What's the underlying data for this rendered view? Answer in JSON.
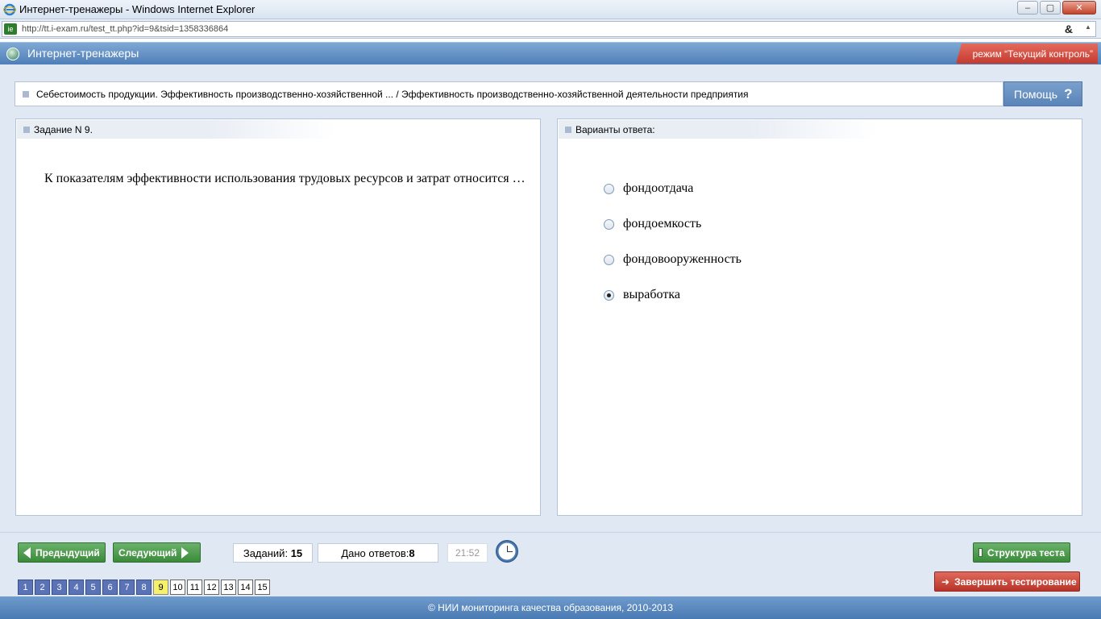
{
  "window": {
    "title": "Интернет-тренажеры - Windows Internet Explorer",
    "url": "http://tt.i-exam.ru/test_tt.php?id=9&tsid=1358336864"
  },
  "header": {
    "app_title": "Интернет-тренажеры",
    "mode": "режим “Текущий контроль”"
  },
  "breadcrumb": "Себестоимость продукции. Эффективность производственно-хозяйственной ... / Эффективность производственно-хозяйственной деятельности предприятия",
  "help_label": "Помощь",
  "task": {
    "heading": "Задание N 9.",
    "question": "К показателям эффективности использования трудовых ресурсов и затрат относится …"
  },
  "answers": {
    "heading": "Варианты ответа:",
    "options": [
      {
        "label": "фондоотдача",
        "selected": false
      },
      {
        "label": "фондоемкость",
        "selected": false
      },
      {
        "label": "фондовооруженность",
        "selected": false
      },
      {
        "label": "выработка",
        "selected": true
      }
    ]
  },
  "toolbar": {
    "prev_label": "Предыдущий",
    "next_label": "Следующий",
    "tasks_label": "Заданий:",
    "tasks_count": "15",
    "answered_label": "Дано ответов:",
    "answered_count": "8",
    "timer": "21:52",
    "structure_label": "Структура теста",
    "finish_label": "Завершить тестирование"
  },
  "pages": [
    {
      "num": "1",
      "state": "answered"
    },
    {
      "num": "2",
      "state": "answered"
    },
    {
      "num": "3",
      "state": "answered"
    },
    {
      "num": "4",
      "state": "answered"
    },
    {
      "num": "5",
      "state": "answered"
    },
    {
      "num": "6",
      "state": "answered"
    },
    {
      "num": "7",
      "state": "answered"
    },
    {
      "num": "8",
      "state": "answered"
    },
    {
      "num": "9",
      "state": "current"
    },
    {
      "num": "10",
      "state": "pending"
    },
    {
      "num": "11",
      "state": "pending"
    },
    {
      "num": "12",
      "state": "pending"
    },
    {
      "num": "13",
      "state": "pending"
    },
    {
      "num": "14",
      "state": "pending"
    },
    {
      "num": "15",
      "state": "pending"
    }
  ],
  "footer": "© НИИ мониторинга качества образования, 2010-2013",
  "colors": {
    "header_blue": "#5a86bd",
    "mode_red": "#d14b3e",
    "nav_green": "#4a9a4a",
    "finish_red": "#c8443a",
    "page_answered": "#5a73b6",
    "page_current": "#f6f06a"
  }
}
